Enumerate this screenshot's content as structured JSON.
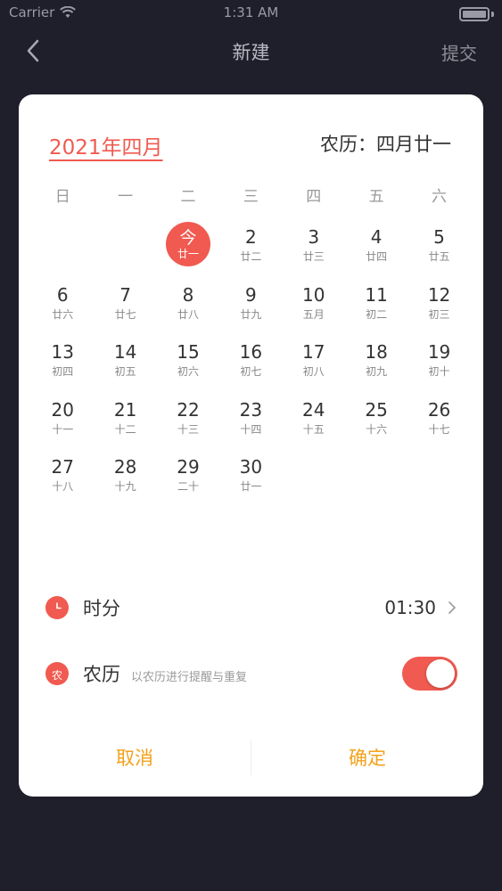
{
  "status_bar": {
    "carrier": "Carrier",
    "time": "1:31 AM"
  },
  "nav": {
    "title": "新建",
    "submit_label": "提交",
    "back_icon": "chevron-left-icon"
  },
  "calendar": {
    "month_title": "2021年四月",
    "lunar_today": "农历：四月廿一",
    "weekdays": [
      "日",
      "一",
      "二",
      "三",
      "四",
      "五",
      "六"
    ],
    "today_label": "今",
    "days": [
      {
        "num": "",
        "lunar": ""
      },
      {
        "num": "",
        "lunar": ""
      },
      {
        "num": "今",
        "lunar": "廿一",
        "today": true
      },
      {
        "num": "2",
        "lunar": "廿二"
      },
      {
        "num": "3",
        "lunar": "廿三"
      },
      {
        "num": "4",
        "lunar": "廿四"
      },
      {
        "num": "5",
        "lunar": "廿五"
      },
      {
        "num": "6",
        "lunar": "廿六"
      },
      {
        "num": "7",
        "lunar": "廿七"
      },
      {
        "num": "8",
        "lunar": "廿八"
      },
      {
        "num": "9",
        "lunar": "廿九"
      },
      {
        "num": "10",
        "lunar": "五月"
      },
      {
        "num": "11",
        "lunar": "初二"
      },
      {
        "num": "12",
        "lunar": "初三"
      },
      {
        "num": "13",
        "lunar": "初四"
      },
      {
        "num": "14",
        "lunar": "初五"
      },
      {
        "num": "15",
        "lunar": "初六"
      },
      {
        "num": "16",
        "lunar": "初七"
      },
      {
        "num": "17",
        "lunar": "初八"
      },
      {
        "num": "18",
        "lunar": "初九"
      },
      {
        "num": "19",
        "lunar": "初十"
      },
      {
        "num": "20",
        "lunar": "十一"
      },
      {
        "num": "21",
        "lunar": "十二"
      },
      {
        "num": "22",
        "lunar": "十三"
      },
      {
        "num": "23",
        "lunar": "十四"
      },
      {
        "num": "24",
        "lunar": "十五"
      },
      {
        "num": "25",
        "lunar": "十六"
      },
      {
        "num": "26",
        "lunar": "十七"
      },
      {
        "num": "27",
        "lunar": "十八"
      },
      {
        "num": "28",
        "lunar": "十九"
      },
      {
        "num": "29",
        "lunar": "二十"
      },
      {
        "num": "30",
        "lunar": "廿一"
      }
    ]
  },
  "time_row": {
    "label": "时分",
    "value": "01:30",
    "icon": "clock-icon"
  },
  "lunar_row": {
    "label": "农历",
    "sublabel": "以农历进行提醒与重复",
    "icon_char": "农",
    "toggle_on": true
  },
  "footer": {
    "cancel_label": "取消",
    "confirm_label": "确定"
  },
  "colors": {
    "accent": "#f05a50",
    "button_text": "#f3a21b",
    "background": "#1f1f2b"
  }
}
